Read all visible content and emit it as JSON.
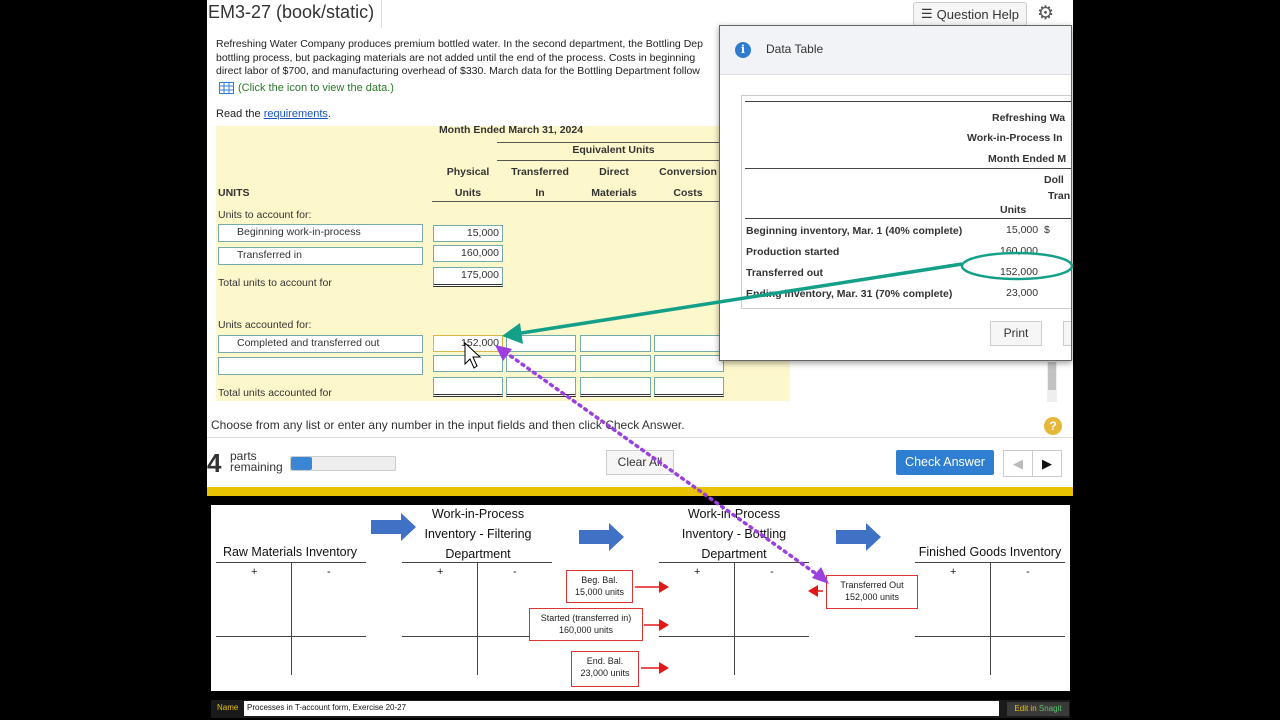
{
  "app": {
    "title": "EM3-27 (book/static)",
    "question_help": "Question Help",
    "problem_lines": [
      "Refreshing Water Company produces premium bottled water. In the second department, the Bottling Dep",
      "bottling process, but packaging materials are not added until the end of the process. Costs in beginning",
      "direct labor of $700, and manufacturing overhead of $330. March data for the Bottling Department follow"
    ],
    "click_icon_text": "(Click the icon to view the data.)",
    "read_prefix": "Read the ",
    "read_link": "requirements",
    "read_suffix": ".",
    "choose_text": "Choose from any list or enter any number in the input fields and then click Check Answer.",
    "parts_number": "4",
    "parts_line1": "parts",
    "parts_line2": "remaining",
    "progress_fraction": 0.2,
    "clear_all": "Clear All",
    "check_answer": "Check Answer",
    "prev_icon": "◀",
    "next_icon": "▶"
  },
  "worksheet": {
    "month_header": "Month Ended March 31, 2024",
    "equiv_units": "Equivalent Units",
    "col_physical_1": "Physical",
    "col_physical_2": "Units",
    "col_transferred_1": "Transferred",
    "col_transferred_2": "In",
    "col_direct_1": "Direct",
    "col_direct_2": "Materials",
    "col_conversion_1": "Conversion",
    "col_conversion_2": "Costs",
    "units_label": "UNITS",
    "units_to_account": "Units to account for:",
    "row_beg_wip": "Beginning work-in-process",
    "row_beg_wip_val": "15,000",
    "row_transferred_in": "Transferred in",
    "row_transferred_in_val": "160,000",
    "total_to_account_label": "Total units to account for",
    "total_to_account_val": "175,000",
    "units_accounted": "Units accounted for:",
    "row_completed": "Completed and transferred out",
    "row_completed_val": "152,000",
    "total_accounted_label": "Total units accounted for"
  },
  "data_table": {
    "title": "Data Table",
    "h1": "Refreshing Wa",
    "h2": "Work-in-Process In",
    "h3": "Month Ended M",
    "col_dollars": "Doll",
    "col_tran": "Tran",
    "col_units": "Units",
    "rows": [
      {
        "label": "Beginning inventory, Mar. 1 (40% complete)",
        "units": "15,000",
        "dollar": "$"
      },
      {
        "label": "Production started",
        "units": "160,000",
        "dollar": ""
      },
      {
        "label": "Transferred out",
        "units": "152,000",
        "dollar": ""
      },
      {
        "label": "Ending inventory, Mar. 31 (70% complete)",
        "units": "23,000",
        "dollar": ""
      }
    ],
    "print": "Print"
  },
  "diagram": {
    "raw_materials": "Raw Materials Inventory",
    "wip_filtering": [
      "Work-in-Process",
      "Inventory - Filtering",
      "Department"
    ],
    "wip_bottling": [
      "Work-in-Process",
      "Inventory  - Bottling",
      "Department"
    ],
    "finished_goods": "Finished Goods Inventory",
    "plus": "+",
    "minus": "-",
    "beg_bal": [
      "Beg. Bal.",
      "15,000 units"
    ],
    "started": [
      "Started (transferred in)",
      "160,000 units"
    ],
    "end_bal": [
      "End. Bal.",
      "23,000 units"
    ],
    "transferred_out": [
      "Transferred Out",
      "152,000 units"
    ],
    "colors": {
      "arrow_blue": "#3f72c4",
      "red": "#e01818",
      "teal": "#14a088",
      "purple": "#9b3fe0"
    }
  },
  "namebar": {
    "label": "Name",
    "value": "Processes in T-account form, Exercise 20-27",
    "edit_prefix": "Edit in ",
    "edit_brand": "Snagit"
  }
}
